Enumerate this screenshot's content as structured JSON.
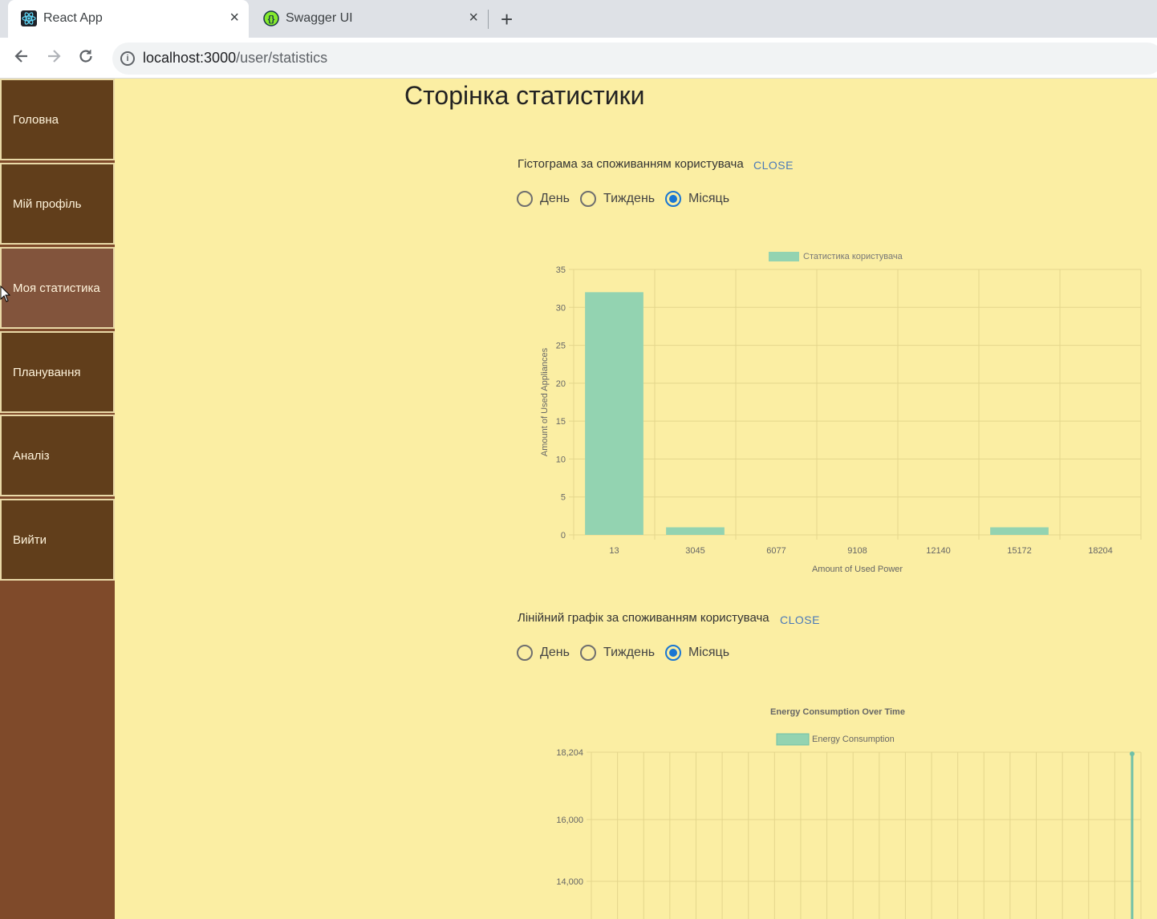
{
  "browser": {
    "tabs": [
      {
        "title": "React App",
        "icon": "react-icon",
        "active": true
      },
      {
        "title": "Swagger UI",
        "icon": "swagger-icon",
        "active": false
      }
    ],
    "url_host": "localhost:3000",
    "url_path": "/user/statistics",
    "new_tab_label": "+",
    "close_glyph": "×"
  },
  "sidebar": {
    "items": [
      {
        "label": "Головна"
      },
      {
        "label": "Мій профіль"
      },
      {
        "label": "Моя статистика",
        "active": true
      },
      {
        "label": "Планування"
      },
      {
        "label": "Аналіз"
      },
      {
        "label": "Вийти"
      }
    ]
  },
  "page": {
    "title": "Сторінка статистики"
  },
  "histogram_section": {
    "label": "Гістограма за споживанням користувача",
    "close_label": "CLOSE",
    "options": [
      {
        "label": "День",
        "checked": false
      },
      {
        "label": "Тиждень",
        "checked": false
      },
      {
        "label": "Місяць",
        "checked": true
      }
    ]
  },
  "line_section": {
    "label": "Лінійний графік за споживанням користувача",
    "close_label": "CLOSE",
    "options": [
      {
        "label": "День",
        "checked": false
      },
      {
        "label": "Тиждень",
        "checked": false
      },
      {
        "label": "Місяць",
        "checked": true
      }
    ]
  },
  "colors": {
    "accent": "#1976d2",
    "bar_fill": "#93d3b1",
    "line": "#6fc0a8",
    "page_bg": "#fbeea3",
    "sidebar_item": "#613e1b"
  },
  "chart_data": [
    {
      "type": "bar",
      "title": "",
      "legend": "Статистика користувача",
      "legend_position": "top",
      "categories": [
        "13",
        "3045",
        "6077",
        "9108",
        "12140",
        "15172",
        "18204"
      ],
      "series": [
        {
          "name": "Статистика користувача",
          "values": [
            32,
            1,
            0,
            0,
            0,
            1,
            0
          ]
        }
      ],
      "xlabel": "Amount of Used Power",
      "ylabel": "Amount of Used Appliances",
      "ylim": [
        0,
        35
      ],
      "yticks": [
        "35",
        "30",
        "25",
        "20",
        "15",
        "10",
        "5",
        "0"
      ],
      "grid": true
    },
    {
      "type": "line",
      "title": "Energy Consumption Over Time",
      "legend": "Energy Consumption",
      "legend_position": "top",
      "yticks": [
        "18,204",
        "16,000",
        "14,000"
      ],
      "grid": true
    }
  ]
}
